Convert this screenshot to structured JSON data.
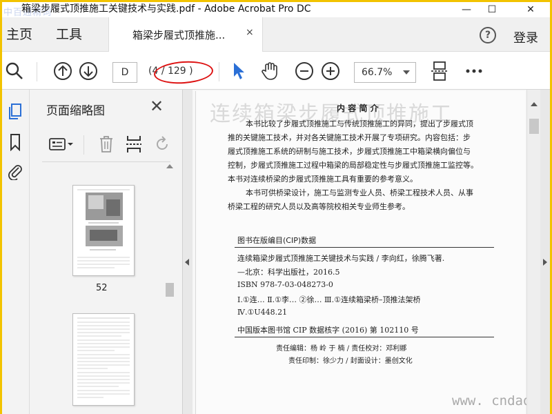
{
  "window": {
    "title": "箱梁步履式顶推施工关键技术与实践.pdf - Adobe Acrobat Pro DC",
    "watermark": "中百通精词",
    "minimize": "—",
    "maximize": "☐",
    "close": "✕"
  },
  "tabs": {
    "home": "主页",
    "tools": "工具",
    "document": "箱梁步履式顶推施...",
    "document_close": "×",
    "help": "?",
    "login": "登录"
  },
  "toolbar": {
    "page_input": "D",
    "page_count": "(4 / 129 )",
    "zoom": "66.7%",
    "icons": [
      "search-icon",
      "page-up-icon",
      "page-down-icon",
      "select-arrow-icon",
      "hand-icon",
      "zoom-out-icon",
      "zoom-in-icon",
      "fit-page-icon",
      "more-icon"
    ]
  },
  "thumbnails": {
    "title": "页面缩略图",
    "close": "✕",
    "page_label": "52",
    "tools": [
      "page-options-icon",
      "trash-icon",
      "insert-page-icon",
      "undo-icon"
    ]
  },
  "document": {
    "bg_title": "连续箱梁步履式顶推施工",
    "heading": "内 容 简 介",
    "intro_lines": [
      "本书比较了步履式顶推施工与传统顶推施工的异同，提出了步履式顶",
      "推的关键施工技术，并对各关键施工技术开展了专项研究。内容包括：步",
      "履式顶推施工系统的研制与施工技术，步履式顶推施工中箱梁横向偏位与",
      "控制，步履式顶推施工过程中箱梁的局部稳定性与步履式顶推施工监控等。",
      "本书对连续桥梁的步履式顶推施工具有重要的参考意义。"
    ],
    "audience_lines": [
      "本书可供桥梁设计，施工与监测专业人员、桥梁工程技术人员、从事",
      "桥梁工程的研究人员以及高等院校相关专业师生参考。"
    ],
    "cip_heading": "图书在版编目(CIP)数据",
    "cip_lines": [
      "连续箱梁步履式顶推施工关键技术与实践 / 李向红，徐腾飞著.",
      "—北京：科学出版社，2016.5",
      "ISBN 978-7-03-048273-0",
      "Ⅰ.①连…  Ⅱ.①李…  ②徐…  Ⅲ.①连续箱梁桥–顶推法架桥",
      "Ⅳ.①U448.21"
    ],
    "cip_number": "中国版本图书馆 CIP 数据核字 (2016) 第 102110 号",
    "credit_line1": "责任编辑：杨  岭  于  楠 / 责任校对：邓利娜",
    "credit_line2": "责任印制：徐少力 / 封面设计：墨创文化",
    "site_watermark": "www. cndao. com"
  }
}
